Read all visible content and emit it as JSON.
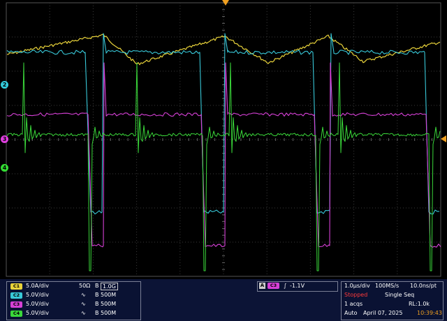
{
  "display": {
    "trigger_marker": "trigger-position-icon",
    "channel_markers": [
      {
        "id": "ch2",
        "label": "2",
        "color": "#33ccdd"
      },
      {
        "id": "ch3",
        "label": "3",
        "color": "#e040e0"
      },
      {
        "id": "ch4",
        "label": "4",
        "color": "#33dd33"
      }
    ],
    "colors": {
      "ch1": "#e8d23a",
      "ch2": "#38c8d8",
      "ch3": "#d640d6",
      "ch4": "#3ad83a",
      "grid": "#3a3a3a"
    }
  },
  "channels": [
    {
      "badge": "C1",
      "scale": "5.0A/div",
      "coupling": "50Ω",
      "bw_label": "1.0G",
      "color": "#e8d23a"
    },
    {
      "badge": "C2",
      "scale": "5.0V/div",
      "coupling": "∿",
      "bw_label": "500M",
      "color": "#38c8d8"
    },
    {
      "badge": "C3",
      "scale": "5.0V/div",
      "coupling": "∿",
      "bw_label": "500M",
      "color": "#d640d6"
    },
    {
      "badge": "C4",
      "scale": "5.0V/div",
      "coupling": "∿",
      "bw_label": "500M",
      "color": "#3ad83a"
    }
  ],
  "bw_prefix": "B",
  "trigger": {
    "mode_badge": "A",
    "source_badge": "C3",
    "slope": "∫",
    "level": "-1.1V"
  },
  "timebase": {
    "time_div": "1.0µs/div",
    "sample_rate": "100MS/s",
    "resolution": "10.0ns/pt",
    "status": "Stopped",
    "seq_mode": "Single Seq",
    "acqs": "1 acqs",
    "record_length": "RL:1.0k",
    "trigger_mode": "Auto",
    "date": "April 07, 2025",
    "time": "10:39:43"
  }
}
